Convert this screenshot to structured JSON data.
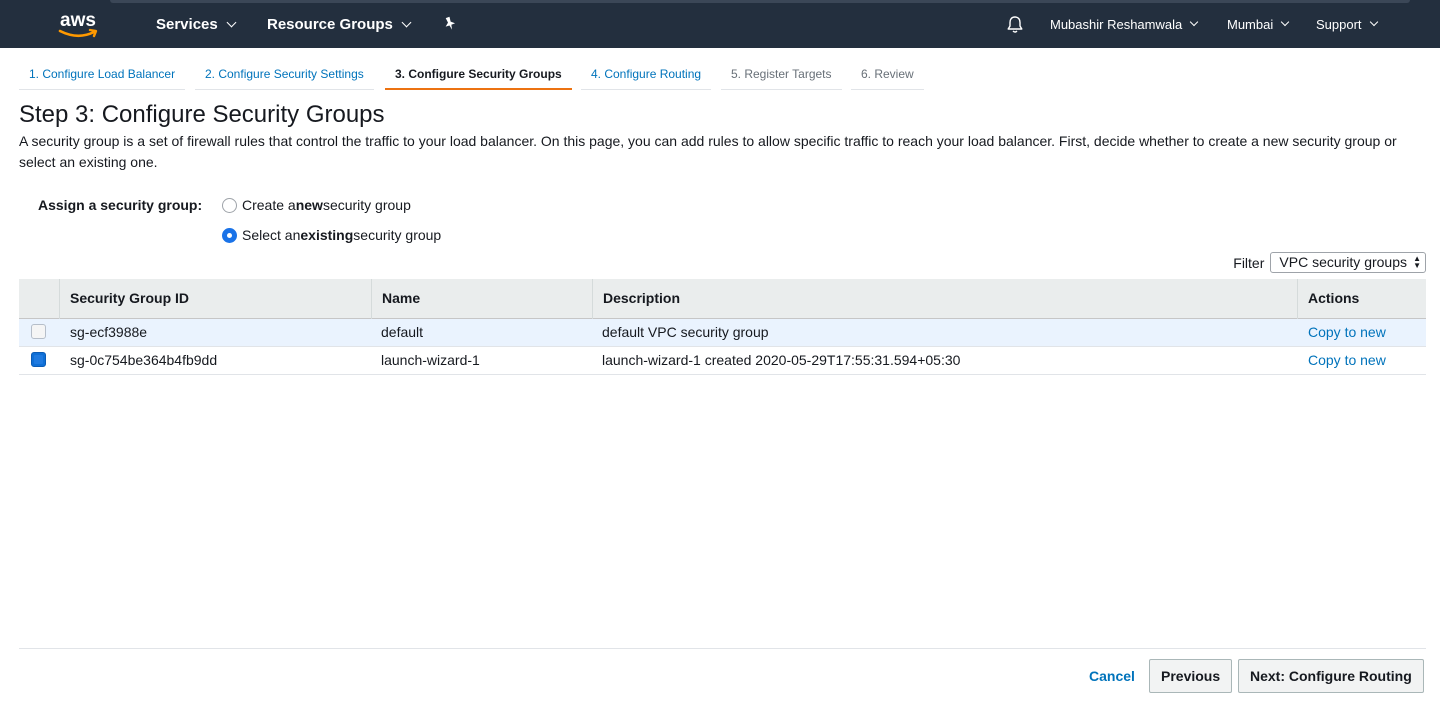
{
  "nav": {
    "logo_text": "aws",
    "services": "Services",
    "resource_groups": "Resource Groups",
    "user": "Mubashir Reshamwala",
    "region": "Mumbai",
    "support": "Support"
  },
  "steps": [
    {
      "label": "1. Configure Load Balancer",
      "state": "link"
    },
    {
      "label": "2. Configure Security Settings",
      "state": "link"
    },
    {
      "label": "3. Configure Security Groups",
      "state": "active"
    },
    {
      "label": "4. Configure Routing",
      "state": "link"
    },
    {
      "label": "5. Register Targets",
      "state": "disabled"
    },
    {
      "label": "6. Review",
      "state": "disabled"
    }
  ],
  "page": {
    "title": "Step 3: Configure Security Groups",
    "description": "A security group is a set of firewall rules that control the traffic to your load balancer. On this page, you can add rules to allow specific traffic to reach your load balancer. First, decide whether to create a new security group or select an existing one."
  },
  "assign": {
    "label": "Assign a security group:",
    "option_new_pre": "Create a ",
    "option_new_bold": "new",
    "option_new_post": " security group",
    "option_existing_pre": "Select an ",
    "option_existing_bold": "existing",
    "option_existing_post": " security group",
    "selected": "existing"
  },
  "filter": {
    "label": "Filter",
    "value": "VPC security groups"
  },
  "table": {
    "columns": [
      "Security Group ID",
      "Name",
      "Description",
      "Actions"
    ],
    "rows": [
      {
        "id": "sg-ecf3988e",
        "name": "default",
        "description": "default VPC security group",
        "action": "Copy to new",
        "checked": false
      },
      {
        "id": "sg-0c754be364b4fb9dd",
        "name": "launch-wizard-1",
        "description": "launch-wizard-1 created 2020-05-29T17:55:31.594+05:30",
        "action": "Copy to new",
        "checked": true
      }
    ]
  },
  "footer": {
    "cancel": "Cancel",
    "previous": "Previous",
    "next": "Next: Configure Routing"
  },
  "colors": {
    "nav_bg": "#232f3e",
    "link": "#0073bb",
    "active_step": "#ec7211",
    "aws_smile": "#ff9900"
  }
}
